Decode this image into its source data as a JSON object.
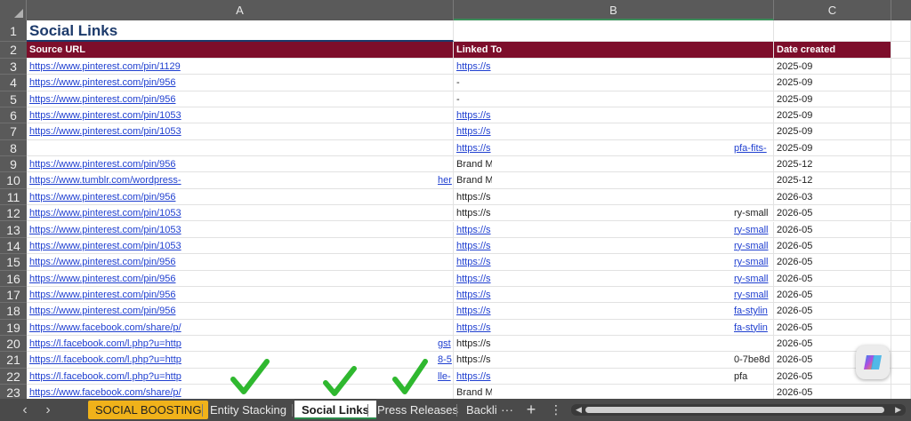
{
  "columns": [
    "A",
    "B",
    "C"
  ],
  "rows": [
    "1",
    "2",
    "3",
    "4",
    "5",
    "6",
    "7",
    "8",
    "9",
    "10",
    "11",
    "12",
    "13",
    "14",
    "15",
    "16",
    "17",
    "18",
    "19",
    "20",
    "21",
    "22",
    "23"
  ],
  "title": "Social Links",
  "headers": {
    "source": "Source URL",
    "linked": "Linked To",
    "date": "Date created"
  },
  "data": [
    {
      "a": "https://www.pinterest.com/pin/1129",
      "a_link": true,
      "b": "https://s",
      "b_link": true,
      "b2": "",
      "b2_link": false,
      "c": "2025-09"
    },
    {
      "a": "https://www.pinterest.com/pin/956",
      "a_link": true,
      "b": "-",
      "b_link": false,
      "b2": "",
      "b2_link": false,
      "c": "2025-09"
    },
    {
      "a": "https://www.pinterest.com/pin/956",
      "a_link": true,
      "b": "-",
      "b_link": false,
      "b2": "",
      "b2_link": false,
      "c": "2025-09"
    },
    {
      "a": "https://www.pinterest.com/pin/1053",
      "a_link": true,
      "b": "https://s",
      "b_link": true,
      "b2": "",
      "b2_link": false,
      "c": "2025-09"
    },
    {
      "a": "https://www.pinterest.com/pin/1053",
      "a_link": true,
      "b": "https://s",
      "b_link": true,
      "b2": "",
      "b2_link": false,
      "c": "2025-09"
    },
    {
      "a": "",
      "a_link": false,
      "b": "https://s",
      "b_link": true,
      "b2": "pfa-fits-",
      "b2_link": true,
      "c": "2025-09"
    },
    {
      "a": "https://www.pinterest.com/pin/956",
      "a_link": true,
      "b": "Brand M",
      "b_link": false,
      "b2": "",
      "b2_link": false,
      "c": "2025-12"
    },
    {
      "a": "https://www.tumblr.com/wordpress-",
      "a_link": true,
      "a2": "her",
      "b": "Brand M",
      "b_link": false,
      "b2": "",
      "b2_link": false,
      "c": "2025-12"
    },
    {
      "a": "https://www.pinterest.com/pin/956",
      "a_link": true,
      "b": "https://s",
      "b_link": false,
      "b2": "",
      "b2_link": false,
      "c": "2026-03"
    },
    {
      "a": "https://www.pinterest.com/pin/1053",
      "a_link": true,
      "b": "https://s",
      "b_link": false,
      "b2": "ry-small",
      "b2_link": false,
      "c": "2026-05"
    },
    {
      "a": "https://www.pinterest.com/pin/1053",
      "a_link": true,
      "b": "https://s",
      "b_link": true,
      "b2": "ry-small",
      "b2_link": true,
      "c": "2026-05"
    },
    {
      "a": "https://www.pinterest.com/pin/1053",
      "a_link": true,
      "b": "https://s",
      "b_link": true,
      "b2": "ry-small",
      "b2_link": true,
      "c": "2026-05"
    },
    {
      "a": "https://www.pinterest.com/pin/956",
      "a_link": true,
      "b": "https://s",
      "b_link": true,
      "b2": "ry-small",
      "b2_link": true,
      "c": "2026-05"
    },
    {
      "a": "https://www.pinterest.com/pin/956",
      "a_link": true,
      "b": "https://s",
      "b_link": true,
      "b2": "ry-small",
      "b2_link": true,
      "c": "2026-05"
    },
    {
      "a": "https://www.pinterest.com/pin/956",
      "a_link": true,
      "b": "https://s",
      "b_link": true,
      "b2": "ry-small",
      "b2_link": true,
      "c": "2026-05"
    },
    {
      "a": "https://www.pinterest.com/pin/956",
      "a_link": true,
      "b": "https://s",
      "b_link": true,
      "b2": "fa-stylin",
      "b2_link": true,
      "c": "2026-05"
    },
    {
      "a": "https://www.facebook.com/share/p/",
      "a_link": true,
      "b": "https://s",
      "b_link": true,
      "b2": "fa-stylin",
      "b2_link": true,
      "c": "2026-05"
    },
    {
      "a": "https://l.facebook.com/l.php?u=http",
      "a_link": true,
      "a2": "gst",
      "b": "https://s",
      "b_link": false,
      "b2": "",
      "b2_link": false,
      "c": "2026-05"
    },
    {
      "a": "https://l.facebook.com/l.php?u=http",
      "a_link": true,
      "a2": "8-5",
      "b": "https://s",
      "b_link": false,
      "b2": "0-7be8d",
      "b2_link": false,
      "c": "2026-05"
    },
    {
      "a": "https://l.facebook.com/l.php?u=http",
      "a_link": true,
      "a2": "lle-",
      "b": "https://s",
      "b_link": true,
      "b2": "pfa",
      "b2_link": false,
      "c": "2026-05"
    },
    {
      "a": "https://www.facebook.com/share/p/",
      "a_link": true,
      "b": "Brand Mention",
      "b_link": false,
      "b2": "",
      "b2_link": false,
      "c": "2026-05"
    }
  ],
  "tabs": [
    {
      "label": "SOCIAL BOOSTING",
      "style": "orange"
    },
    {
      "label": "Entity Stacking",
      "style": "normal"
    },
    {
      "label": "Social Links",
      "style": "active"
    },
    {
      "label": "Press Releases",
      "style": "normal"
    },
    {
      "label": "Backli",
      "style": "normal"
    }
  ],
  "toolbar": {
    "more": "···",
    "add": "+",
    "menu": "⋮",
    "prev": "‹",
    "next": "›"
  },
  "colors": {
    "header_fill": "#7d0e2b",
    "title_text": "#1c3a6b",
    "link": "#1f3fd0",
    "check": "#2fb82f",
    "tab_orange": "#f0b21a"
  },
  "icons": {
    "copilot": "copilot-icon",
    "check": "checkmark-icon"
  }
}
